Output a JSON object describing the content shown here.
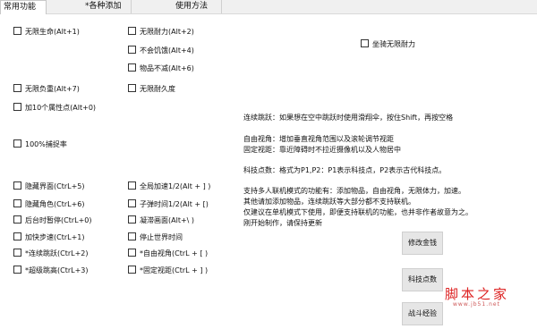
{
  "tabs": [
    "常用功能",
    "*各种添加",
    "使用方法"
  ],
  "checkboxes": {
    "c1": [
      "无限生命(Alt+1)",
      "无限负重(Alt+7)",
      "加10个属性点(Alt+0)",
      "100%捕捉率",
      "隐藏界面(CtrL+5)",
      "隐藏角色(CtrL+6)",
      "后台时暂停(CtrL+0)",
      "加快步速(CtrL+1)",
      "*连续跳跃(CtrL+2)",
      "*超级跳高(CtrL+3)"
    ],
    "c2": [
      "无限耐力(Alt+2)",
      "不会饥饿(Alt+4)",
      "物品不减(Alt+6)",
      "无限耐久度",
      "全局加速1/2(Alt + ] )",
      "子弹时间1/2(Alt + [)",
      "凝滞画面(Alt+\\ )",
      "停止世界时间",
      "*自由视角(CtrL + [ )",
      "*固定视距(CtrL + ] )"
    ],
    "c3": [
      "坐骑无限耐力"
    ]
  },
  "notes": [
    "连续跳跃：如果想在空中跳跃时使用滑翔伞，按住Shift，再按空格",
    "自由视角：增加垂直视角范围以及滚轮调节视距",
    "固定视距：靠近障碍时不拉近摄像机以及人物居中",
    "科技点数：格式为P1,P2：P1表示科技点，P2表示古代科技点。",
    "支持多人联机模式的功能有：添加物品，自由视角，无限体力，加速。",
    "其他请加添加物品，连续跳跃等大部分都不支持联机。",
    "仅建议在单机模式下使用，即便支持联机的功能，也并非作者故意为之。",
    "刚开始制作，请保持更新"
  ],
  "buttons": [
    "修改金钱",
    "科技点数",
    "战斗经验"
  ],
  "watermark": {
    "text": "脚本之家",
    "url": "www.jb51.net"
  }
}
